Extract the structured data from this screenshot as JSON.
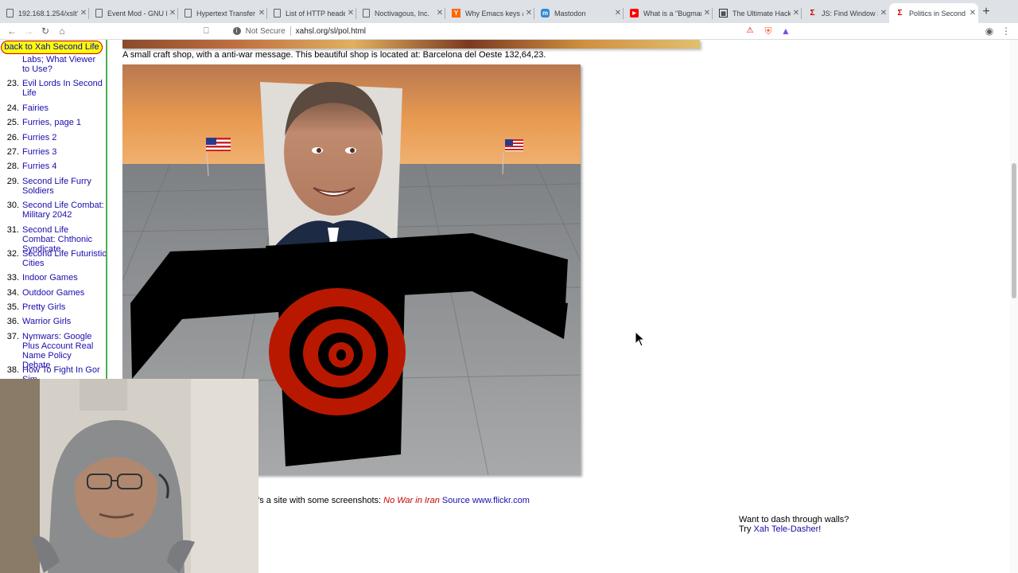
{
  "tabs": [
    {
      "title": "192.168.1.254/xslt?...",
      "favicon": "doc-icon"
    },
    {
      "title": "Event Mod - GNU E...",
      "favicon": "doc-icon"
    },
    {
      "title": "Hypertext Transfer ...",
      "favicon": "doc-icon"
    },
    {
      "title": "List of HTTP heade...",
      "favicon": "doc-icon"
    },
    {
      "title": "Noctivagous, Inc.",
      "favicon": "doc-icon"
    },
    {
      "title": "Why Emacs keys ar...",
      "favicon": "hackernews-icon"
    },
    {
      "title": "Mastodon",
      "favicon": "mastodon-icon"
    },
    {
      "title": "What is a \"Bugman\"...",
      "favicon": "youtube-icon"
    },
    {
      "title": "The Ultimate Hacki...",
      "favicon": "site-icon"
    },
    {
      "title": "JS: Find Window Si...",
      "favicon": "sigma-icon"
    },
    {
      "title": "Politics in Second L...",
      "favicon": "sigma-icon",
      "active": true
    }
  ],
  "toolbar": {
    "security_label": "Not Secure",
    "url": "xahsl.org/sl/pol.html"
  },
  "sidebar": {
    "back_label": "back to Xah Second Life",
    "continued_label": "Labs; What Viewer to Use?",
    "items": [
      {
        "num": "23.",
        "label": "Evil Lords In Second Life"
      },
      {
        "num": "24.",
        "label": "Fairies"
      },
      {
        "num": "25.",
        "label": "Furries, page 1"
      },
      {
        "num": "26.",
        "label": "Furries 2"
      },
      {
        "num": "27.",
        "label": "Furries 3"
      },
      {
        "num": "28.",
        "label": "Furries 4"
      },
      {
        "num": "29.",
        "label": "Second Life Furry Soldiers"
      },
      {
        "num": "30.",
        "label": "Second Life Combat: Military 2042"
      },
      {
        "num": "31.",
        "label": "Second Life Combat: Chthonic Syndicate"
      },
      {
        "num": "32.",
        "label": "Second Life Futuristic Cities"
      },
      {
        "num": "33.",
        "label": "Indoor Games"
      },
      {
        "num": "34.",
        "label": "Outdoor Games"
      },
      {
        "num": "35.",
        "label": "Pretty Girls"
      },
      {
        "num": "36.",
        "label": "Warrior Girls"
      },
      {
        "num": "37.",
        "label": "Nymwars: Google Plus Account Real Name Policy Debate"
      },
      {
        "num": "38.",
        "label": "How To Fight In Gor Sim"
      }
    ]
  },
  "content": {
    "caption": "A small craft shop, with a anti-war message. This beautiful shop is located at: Barcelona del Oeste 132,64,23.",
    "line2_prefix": "e's a site with some screenshots:",
    "line2_italic": "No War in Iran",
    "line2_source": "Source",
    "line2_link": "www.flickr.com",
    "dash_line1": "Want to dash through walls?",
    "dash_try": "Try",
    "dash_link": "Xah Tele-Dasher",
    "dash_end": "!"
  },
  "colors": {
    "link": "#1a0dab",
    "back_button_bg": "#ffff00",
    "sidebar_border": "#4caf50",
    "italic_red": "#cc0000"
  }
}
